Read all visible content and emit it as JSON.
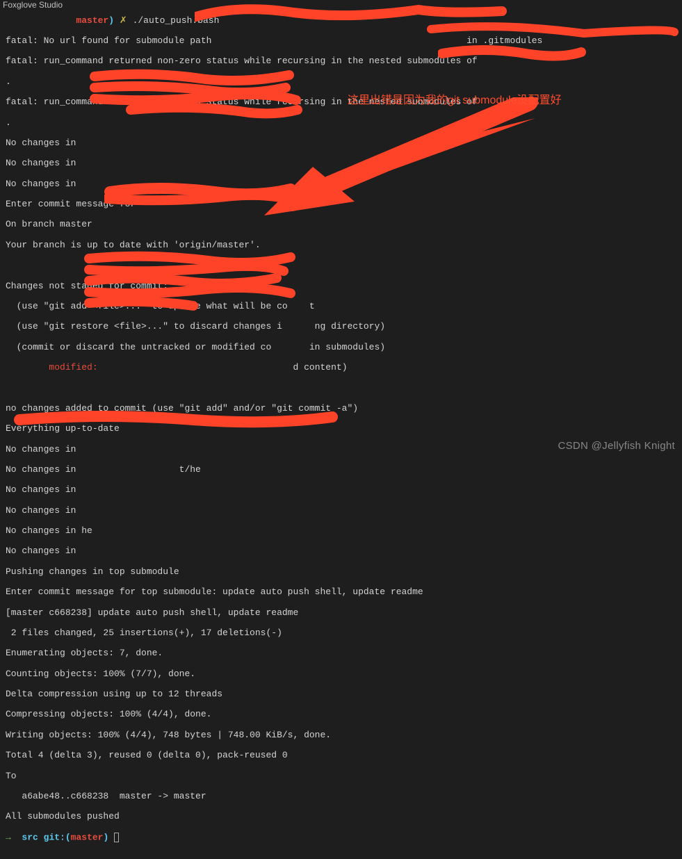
{
  "app_label": "Foxglove Studio",
  "annotation": "这里出错是因为我的git submodule没配置好",
  "watermark": "CSDN @Jellyfish Knight",
  "prompt": {
    "arrow": "→ ",
    "path": "src",
    "git_label": "git:",
    "branch": "master",
    "lparen": "(",
    "rparen": ")",
    "sym": "✗"
  },
  "command": "./auto_push.bash",
  "lines": {
    "l1a": "fatal: No url found for submodule path ",
    "l1b": " in .gitmodules",
    "l2": "fatal: run_command returned non-zero status while recursing in the nested submodules of",
    "l3": ".",
    "l4a": "fatal: run_command returned non-zero status while recursing in the nested submodules of ",
    "l5": ".",
    "l6": "No changes in   ",
    "l7": "No changes in   ",
    "l8": "No changes in  ",
    "l9": "Enter commit message for  ",
    "l10": "On branch master",
    "l11": "Your branch is up to date with 'origin/master'.",
    "l12": "",
    "l13": "Changes not staged for commit:",
    "l14": "  (use \"git add <file>...\" to update what will be co    t",
    "l15": "  (use \"git restore <file>...\" to discard changes i      ng directory)",
    "l16": "  (commit or discard the untracked or modified co       in submodules)",
    "l17a": "        modified:   ",
    "l17b": "d content)",
    "l18": "",
    "l19": "no changes added to commit (use \"git add\" and/or \"git commit -a\")",
    "l20": "Everything up-to-date",
    "l21": "No changes in  ",
    "l22": "No changes in  ",
    "l22b": "t/he",
    "l23": "No changes in   ",
    "l24": "No changes in  ",
    "l25": "No changes in he   ",
    "l26": "No changes in   ",
    "l27": "Pushing changes in top submodule",
    "l28": "Enter commit message for top submodule: update auto push shell, update readme",
    "l29": "[master c668238] update auto push shell, update readme",
    "l30": " 2 files changed, 25 insertions(+), 17 deletions(-)",
    "l31": "Enumerating objects: 7, done.",
    "l32": "Counting objects: 100% (7/7), done.",
    "l33": "Delta compression using up to 12 threads",
    "l34": "Compressing objects: 100% (4/4), done.",
    "l35": "Writing objects: 100% (4/4), 748 bytes | 748.00 KiB/s, done.",
    "l36": "Total 4 (delta 3), reused 0 (delta 0), pack-reused 0",
    "l37": "To",
    "l38": "   a6abe48..c668238  master -> master",
    "l39": "All submodules pushed"
  }
}
